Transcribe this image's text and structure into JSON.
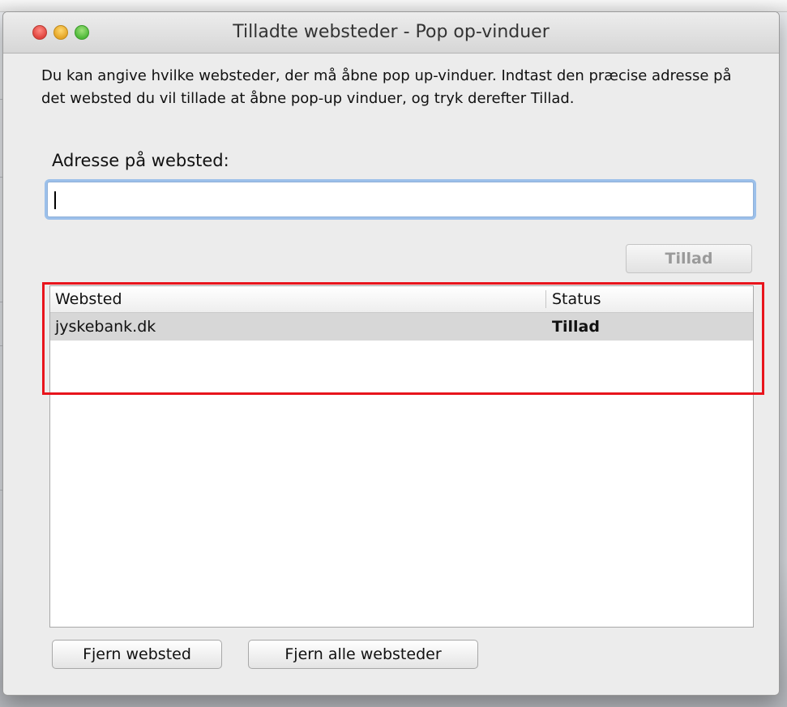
{
  "window": {
    "title": "Tilladte websteder - Pop op-vinduer"
  },
  "description": "Du kan angive hvilke websteder, der må åbne pop up-vinduer. Indtast den præcise adresse på det websted du vil tillade at åbne pop-up vinduer, og tryk derefter Tillad.",
  "address": {
    "label": "Adresse på websted:",
    "value": "",
    "placeholder": ""
  },
  "allow_button": "Tillad",
  "list": {
    "columns": [
      "Websted",
      "Status"
    ],
    "rows": [
      {
        "site": "jyskebank.dk",
        "status": "Tillad"
      }
    ]
  },
  "buttons": {
    "remove": "Fjern websted",
    "remove_all": "Fjern alle websteder"
  },
  "colors": {
    "highlight": "#e8141c",
    "focus_ring": "#9cc0ea"
  }
}
